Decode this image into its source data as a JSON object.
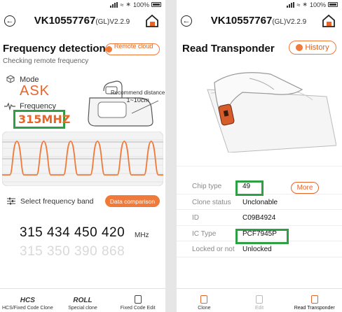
{
  "status": {
    "battery": "100%"
  },
  "colors": {
    "accent": "#f07a3a",
    "highlight": "#2ea043",
    "mode_text": "#e8652a"
  },
  "left": {
    "title": {
      "device": "VK10557767",
      "version": "(GL)V2.2.9"
    },
    "section_title": "Frequency detection",
    "remote_cloud_label": "Remote cloud ...",
    "subtitle": "Checking remote frequency",
    "mode_label": "Mode",
    "mode_value": "ASK",
    "frequency_label": "Frequency",
    "frequency_value": "315MHZ",
    "recommend": {
      "line1": "Recommend distance",
      "line2": "1~10cm"
    },
    "select_band_label": "Select frequency band",
    "data_comparison_label": "Data comparison",
    "frequencies_row1": [
      "315",
      "434",
      "450",
      "420"
    ],
    "frequencies_row2": [
      "315",
      "350",
      "390",
      "868"
    ],
    "unit": "MHz",
    "nav": [
      {
        "icon": "hcs-icon",
        "icon_text": "HCS",
        "label": "HCS/Fixed Code Clone"
      },
      {
        "icon": "roll-icon",
        "icon_text": "ROLL",
        "label": "Special clone"
      },
      {
        "icon": "edit-icon",
        "icon_text": "",
        "label": "Fixed Code Edit"
      }
    ]
  },
  "right": {
    "title": {
      "device": "VK10557767",
      "version": "(GL)V2.2.9"
    },
    "section_title": "Read Transponder",
    "history_label": "History",
    "rows": [
      {
        "key": "Chip type",
        "value": "49"
      },
      {
        "key": "Clone status",
        "value": "Unclonable"
      },
      {
        "key": "ID",
        "value": "C09B4924"
      },
      {
        "key": "IC Type",
        "value": "PCF7945P"
      },
      {
        "key": "Locked or not",
        "value": "Unlocked"
      }
    ],
    "more_label": "More",
    "nav": [
      {
        "icon": "clone-icon",
        "label": "Clone"
      },
      {
        "icon": "edit-icon",
        "label": "Edit"
      },
      {
        "icon": "read-transponder-icon",
        "label": "Read Transponder"
      }
    ]
  }
}
